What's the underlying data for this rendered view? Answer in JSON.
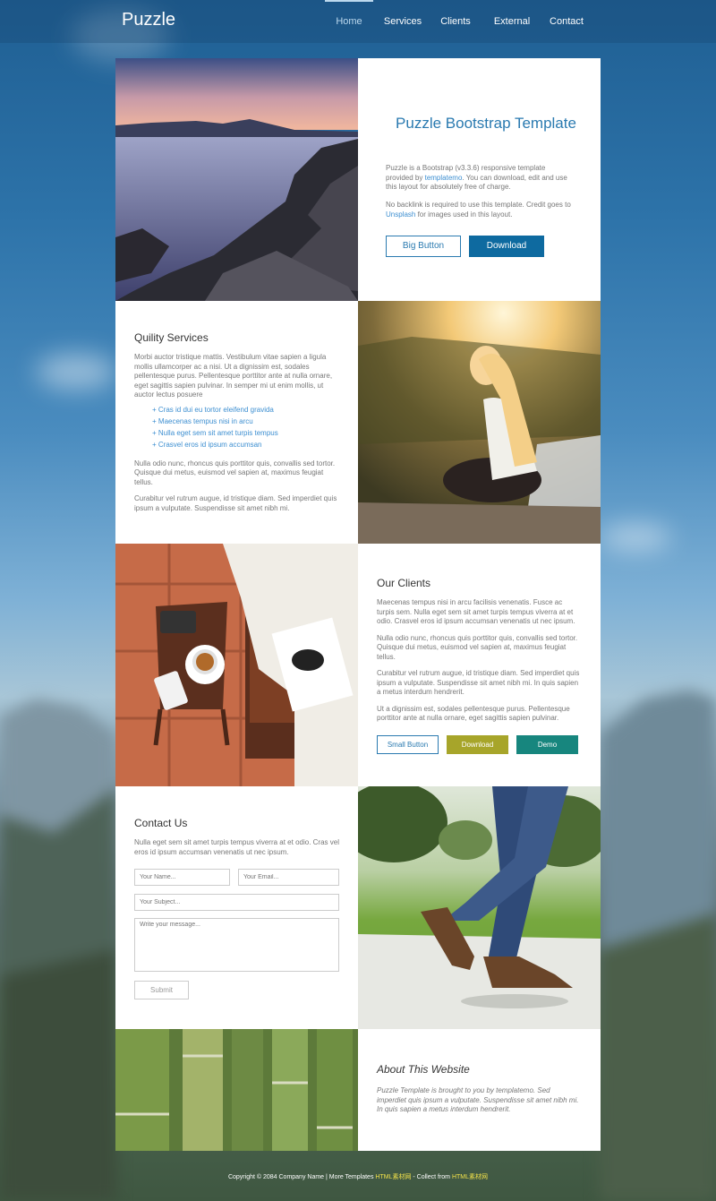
{
  "brand": "Puzzle",
  "nav": [
    {
      "label": "Home",
      "active": true
    },
    {
      "label": "Services",
      "active": false
    },
    {
      "label": "Clients",
      "active": false
    },
    {
      "label": "External",
      "active": false
    },
    {
      "label": "Contact",
      "active": false
    }
  ],
  "hero": {
    "title": "Puzzle Bootstrap Template",
    "p1_a": "Puzzle is a Bootstrap (v3.3.6) responsive template provided by ",
    "p1_link": "templatemo",
    "p1_b": ". You can download, edit and use this layout for absolutely free of charge.",
    "p2_a": "No backlink is required to use this template. Credit goes to ",
    "p2_link": "Unsplash",
    "p2_b": " for images used in this layout.",
    "btn_big": "Big Button",
    "btn_download": "Download"
  },
  "services": {
    "title": "Quility Services",
    "p1": "Morbi auctor tristique mattis. Vestibulum vitae sapien a ligula mollis ullamcorper ac a nisi. Ut a dignissim est, sodales pellentesque purus. Pellentesque porttitor ante at nulla ornare, eget sagittis sapien pulvinar. In semper mi ut enim mollis, ut auctor lectus posuere",
    "list": [
      "Cras id dui eu tortor eleifend gravida",
      "Maecenas tempus nisi in arcu",
      "Nulla eget sem sit amet turpis tempus",
      "Crasvel eros id ipsum accumsan"
    ],
    "p2": "Nulla odio nunc, rhoncus quis porttitor quis, convallis sed tortor. Quisque dui metus, euismod vel sapien at, maximus feugiat tellus.",
    "p3": "Curabitur vel rutrum augue, id tristique diam. Sed imperdiet quis ipsum a vulputate. Suspendisse sit amet nibh mi."
  },
  "clients": {
    "title": "Our Clients",
    "p1": "Maecenas tempus nisi in arcu facilisis venenatis. Fusce ac turpis sem. Nulla eget sem sit amet turpis tempus viverra at et odio. Crasvel eros id ipsum accumsan venenatis ut nec ipsum.",
    "p2": "Nulla odio nunc, rhoncus quis porttitor quis, convallis sed tortor. Quisque dui metus, euismod vel sapien at, maximus feugiat tellus.",
    "p3": "Curabitur vel rutrum augue, id tristique diam. Sed imperdiet quis ipsum a vulputate. Suspendisse sit amet nibh mi. In quis sapien a metus interdum hendrerit.",
    "p4": "Ut a dignissim est, sodales pellentesque purus. Pellentesque porttitor ante at nulla ornare, eget sagittis sapien pulvinar.",
    "btn_small": "Small Button",
    "btn_download": "Download",
    "btn_demo": "Demo"
  },
  "contact": {
    "title": "Contact Us",
    "p1": "Nulla eget sem sit amet turpis tempus viverra at et odio. Cras vel eros id ipsum accumsan venenatis ut nec ipsum.",
    "name_placeholder": "Your Name...",
    "email_placeholder": "Your Email...",
    "subject_placeholder": "Your Subject...",
    "message_placeholder": "Write your message...",
    "submit": "Submit"
  },
  "about": {
    "title": "About This Website",
    "p1": "Puzzle Template is brought to you by templatemo. Sed imperdiet quis ipsum a vulputate. Suspendisse sit amet nibh mi. In quis sapien a metus interdum hendrerit."
  },
  "footer": {
    "a": "Copyright © 2084 Company Name | More Templates ",
    "link1": "HTML素材网",
    "b": " - Collect from ",
    "link2": "HTML素材网"
  }
}
